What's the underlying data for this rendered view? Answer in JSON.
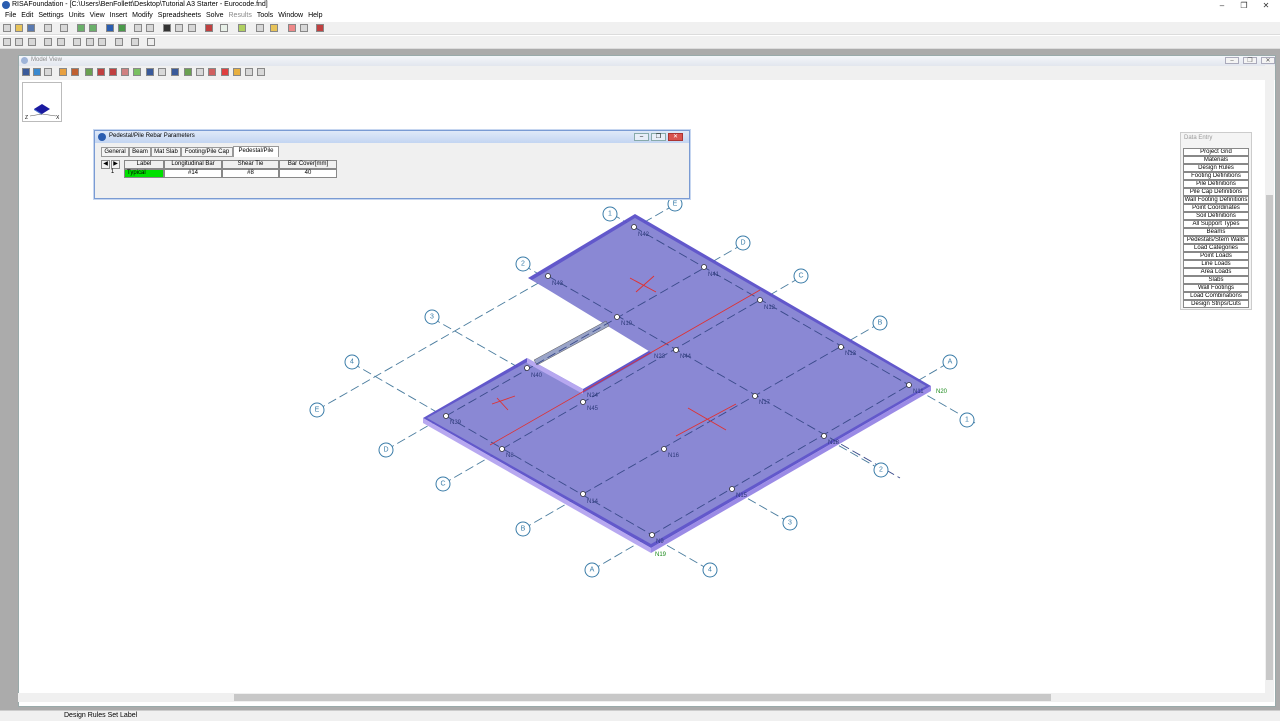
{
  "window": {
    "title": "RISAFoundation - [C:\\Users\\BenFollett\\Desktop\\Tutorial A3 Starter - Eurocode.fnd]"
  },
  "menu": [
    "File",
    "Edit",
    "Settings",
    "Units",
    "View",
    "Insert",
    "Modify",
    "Spreadsheets",
    "Solve",
    "Results",
    "Tools",
    "Window",
    "Help"
  ],
  "model_view": {
    "title": "Model View"
  },
  "rebar_dialog": {
    "title": "Pedestal/Pile Rebar Parameters",
    "tabs": [
      "General",
      "Beam",
      "Mat Slab",
      "Footing/Pile Cap",
      "Pedestal/Pile"
    ],
    "active_tab": "Pedestal/Pile",
    "columns": [
      "Label",
      "Longitudinal Bar",
      "Shear Tie",
      "Bar Cover[mm]"
    ],
    "rows": [
      {
        "num": "1",
        "label": "Typical",
        "long_bar": "#14",
        "shear_tie": "#8",
        "cover": "40"
      }
    ],
    "label_color": "#00e000"
  },
  "data_entry": {
    "title": "Data Entry",
    "items": [
      "Project Grid",
      "Materials",
      "Design Rules",
      "Footing Definitions",
      "Pile Definitions",
      "Pile Cap Definitions",
      "Wall Footing Definitions",
      "Point Coordinates",
      "Soil Definitions",
      "All Support Types",
      "Beams",
      "Pedestals/Stem Walls",
      "Load Categories",
      "Point Loads",
      "Line Loads",
      "Area Loads",
      "Slabs",
      "Wall Footings",
      "Load Combinations",
      "Design Strips/Cuts"
    ]
  },
  "viewcube": {
    "axis_z": "Z",
    "axis_x": "X"
  },
  "model": {
    "slab_color": "#8a88d4",
    "edge_color": "#5a4fc8",
    "grid_bubbles": [
      "1",
      "2",
      "3",
      "4",
      "E",
      "D",
      "C",
      "B",
      "A",
      "A",
      "B",
      "C",
      "D",
      "E",
      "1",
      "2",
      "3",
      "4"
    ],
    "nodes": [
      "N42",
      "N43",
      "N41",
      "N10",
      "N12",
      "N13",
      "N44",
      "N23",
      "N40",
      "N24",
      "N45",
      "N17",
      "N11",
      "N20",
      "N39",
      "N8",
      "N16",
      "N18",
      "N14",
      "N15",
      "N9",
      "N19"
    ]
  },
  "status": {
    "text": "Design Rules Set Label"
  }
}
